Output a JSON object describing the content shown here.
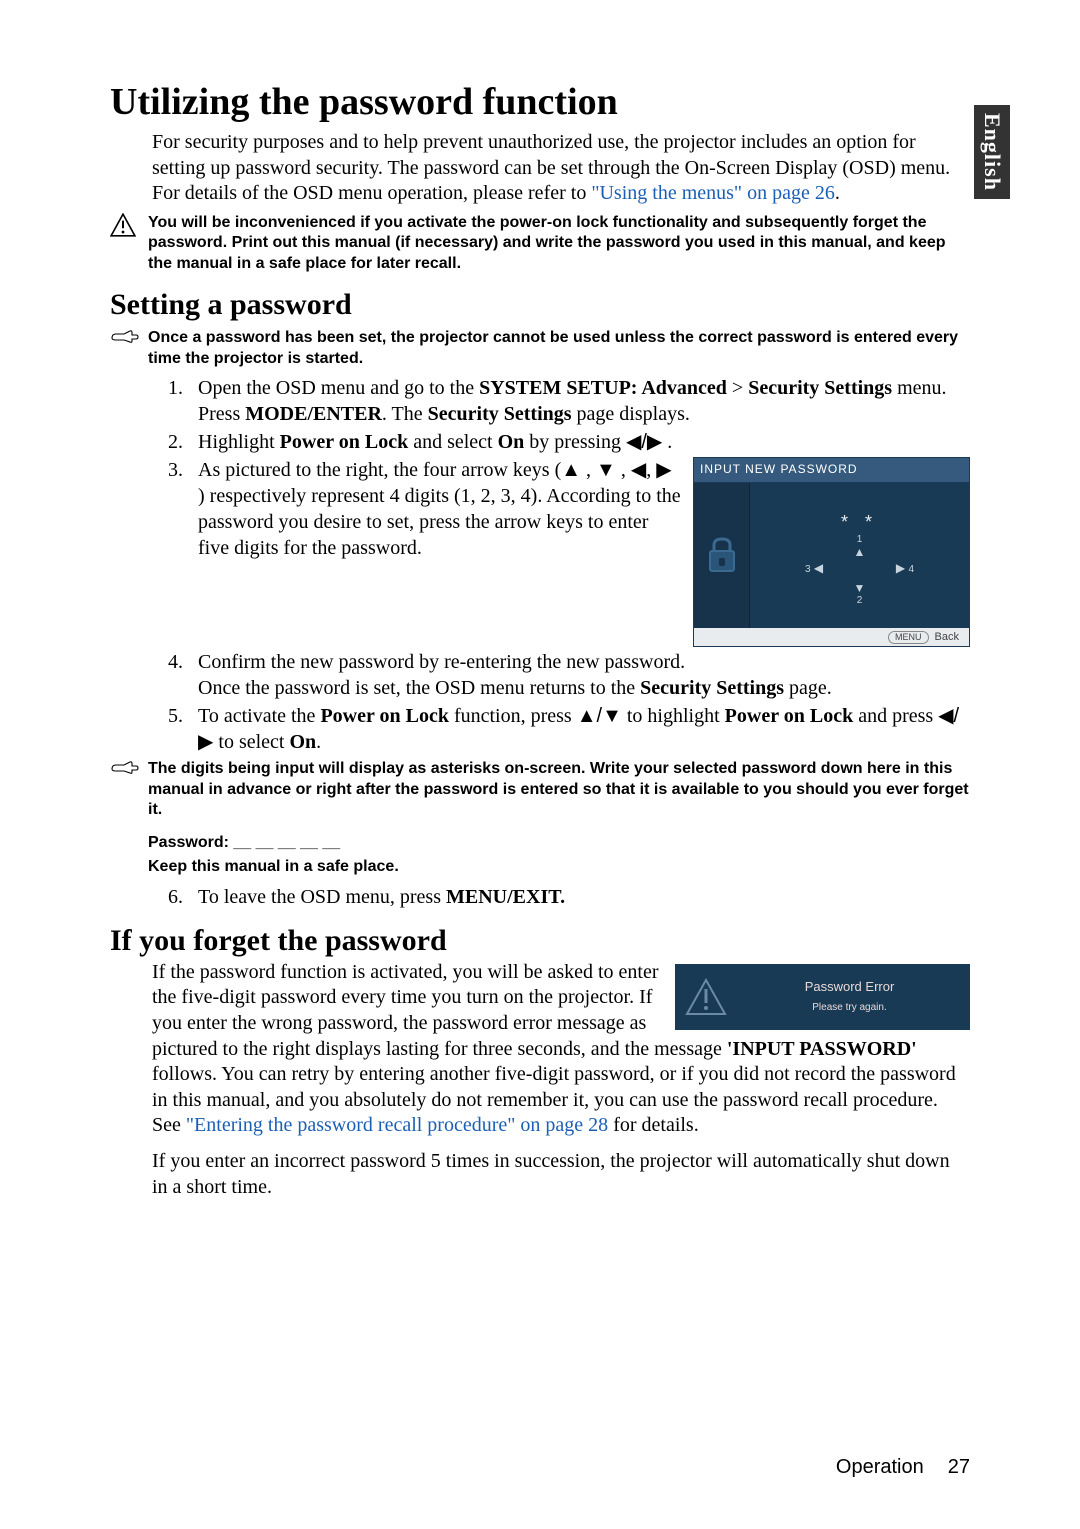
{
  "side_tab": "English",
  "main_title": "Utilizing the password function",
  "intro_before_link": "For security purposes and to help prevent unauthorized use, the projector includes an option for setting up password security. The password can be set through the On-Screen Display (OSD) menu. For details of the OSD menu operation, please refer to ",
  "intro_link": "\"Using the menus\" on page 26",
  "intro_after_link": ".",
  "warning1": "You will be inconvenienced if you activate the power-on lock functionality and subsequently forget the password. Print out this manual (if necessary) and write the password you used in this manual, and keep the manual in a safe place for later recall.",
  "setting_heading": "Setting a password",
  "note1": "Once a password has been set, the projector cannot be used unless the correct password is entered every time the projector is started.",
  "step1_pre": "Open the OSD menu and go to the ",
  "step1_b1": "SYSTEM SETUP: Advanced",
  "step1_gt": " > ",
  "step1_b2": "Security Settings",
  "step1_mid": " menu. Press ",
  "step1_b3": "MODE/ENTER",
  "step1_mid2": ". The ",
  "step1_b4": "Security Settings",
  "step1_end": " page displays.",
  "step2_pre": "Highlight ",
  "step2_b1": "Power on Lock",
  "step2_mid": " and select ",
  "step2_b2": "On",
  "step2_mid2": " by pressing ",
  "step2_arrows": "◀/▶",
  "step2_end": " .",
  "step3_pre": "As pictured to the right, the four arrow keys (",
  "step3_up": "▲",
  "step3_c1": " , ",
  "step3_down": "▼",
  "step3_c2": " , ",
  "step3_left": "◀",
  "step3_c3": ", ",
  "step3_right": "▶",
  "step3_end": " ) respectively represent 4 digits (1, 2, 3, 4). According to the password you desire to set, press the arrow keys to enter five digits for the password.",
  "step4": "Confirm the new password by re-entering the new password.",
  "step4_after_pre": "Once the password is set, the OSD menu returns to the ",
  "step4_after_b": "Security Settings",
  "step4_after_end": " page.",
  "step5_pre": "To activate the ",
  "step5_b1": "Power on Lock",
  "step5_mid": " function, press ",
  "step5_ud": "▲/▼",
  "step5_mid2": " to highlight ",
  "step5_b2": "Power on Lock",
  "step5_mid3": " and press ",
  "step5_lr": "◀/▶",
  "step5_mid4": " to select ",
  "step5_b3": "On",
  "step5_end": ".",
  "note2": "The digits being input will display as asterisks on-screen. Write your selected password down here in this manual in advance or right after the password is entered so that it is available to you should you ever forget it.",
  "pw_label": "Password: __ __ __ __ __",
  "keep_safe": "Keep this manual in a safe place.",
  "step6_pre": "To leave the OSD menu, press ",
  "step6_b": "MENU/EXIT.",
  "forget_heading": "If you forget the password",
  "forget_p1_pre": "If the password function is activated, you will be asked to enter the five-digit password every time you turn on the projector. If you enter the wrong password, the password error message as pictured to the right displays lasting for three seconds, and the message ",
  "forget_p1_b": "'INPUT PASSWORD'",
  "forget_p1_mid": " follows. You can retry by entering another five-digit password, or if you did not record the password in this manual, and you absolutely do not remember it, you can use the password recall procedure. See ",
  "forget_p1_link": "\"Entering the password recall procedure\" on page 28",
  "forget_p1_end": " for details.",
  "forget_p2": "If you enter an incorrect password 5 times in succession, the projector will automatically shut down in a short time.",
  "osd": {
    "header": "INPUT NEW PASSWORD",
    "stars": "* *",
    "num_up": "1",
    "tri_up": "▲",
    "num_left": "3",
    "tri_left": "◀",
    "tri_right": "▶",
    "num_right": "4",
    "tri_down": "▼",
    "num_down": "2",
    "menu_pill": "MENU",
    "back": "Back"
  },
  "error_box": {
    "title": "Password Error",
    "sub": "Please try again."
  },
  "footer": {
    "section": "Operation",
    "pagenum": "27"
  }
}
